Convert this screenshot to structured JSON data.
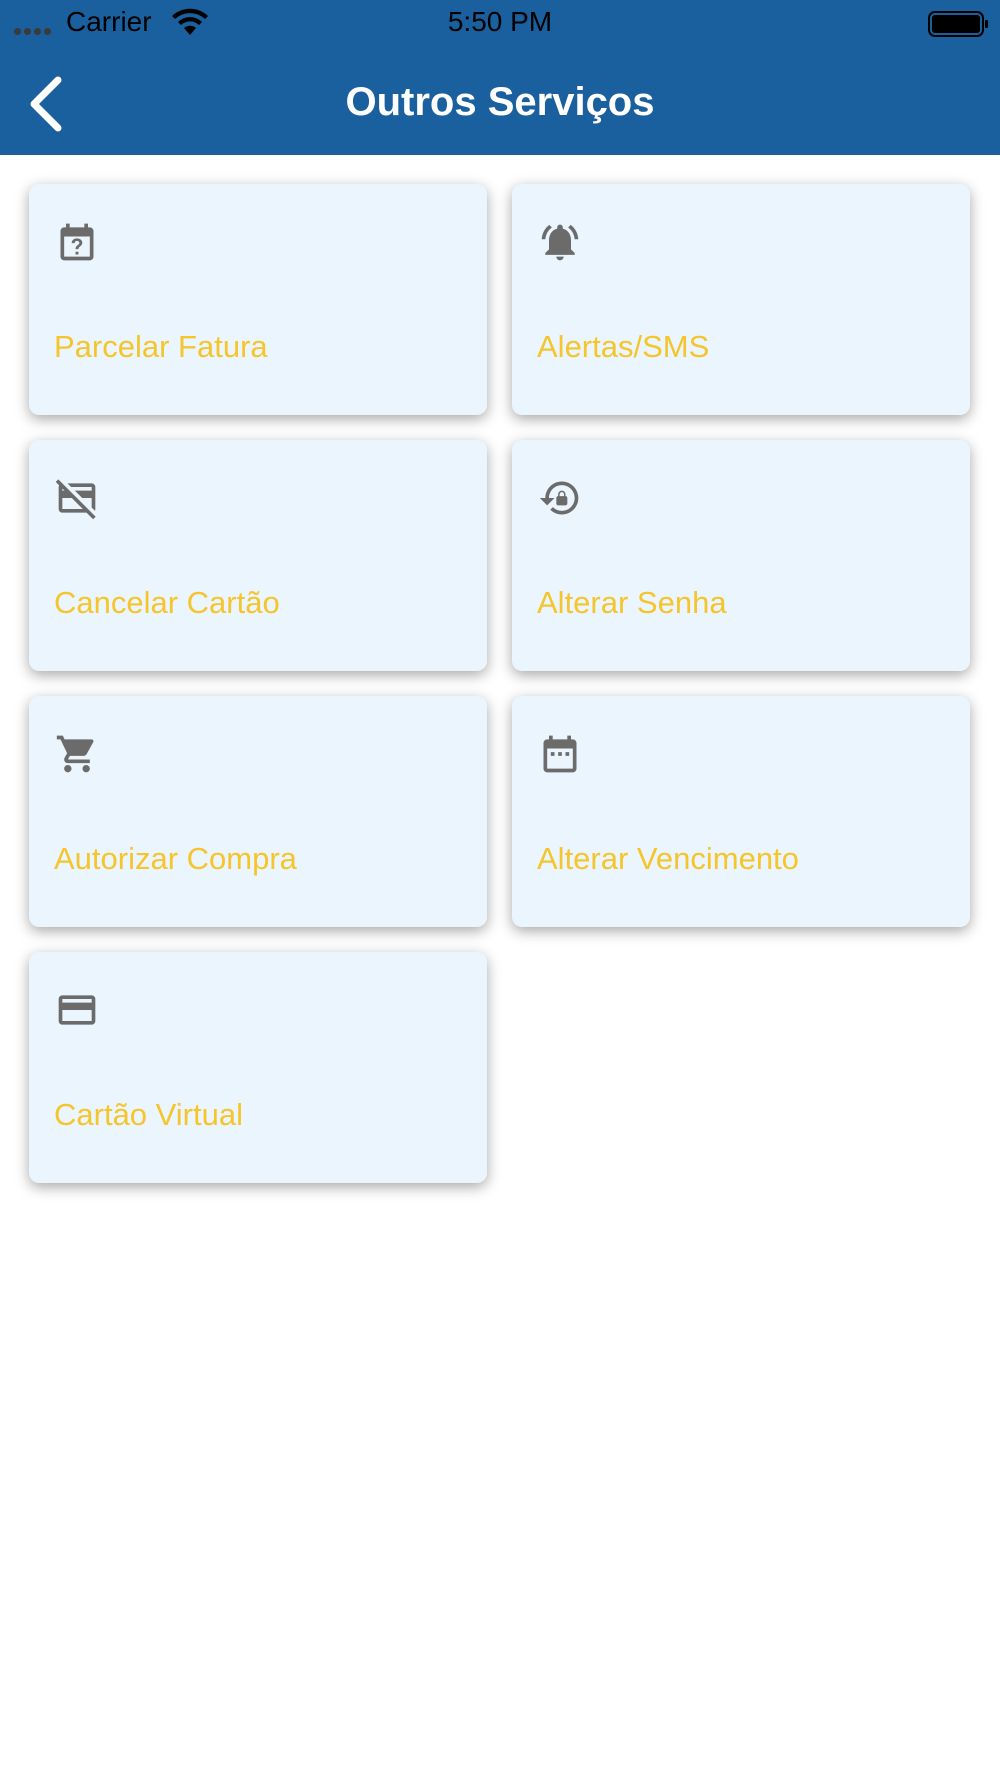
{
  "status_bar": {
    "carrier": "Carrier",
    "time": "5:50 PM"
  },
  "header": {
    "title": "Outros Serviços",
    "back_icon": "chevron-left-icon",
    "background_color": "#1a5f9e"
  },
  "colors": {
    "tile_background": "#eaf5fd",
    "tile_label": "#f5c52b",
    "icon": "#6b6b6b"
  },
  "services": [
    {
      "label": "Parcelar Fatura",
      "icon": "calendar-question-icon"
    },
    {
      "label": "Alertas/SMS",
      "icon": "bell-ringing-icon"
    },
    {
      "label": "Cancelar Cartão",
      "icon": "card-off-icon"
    },
    {
      "label": "Alterar Senha",
      "icon": "lock-reset-icon"
    },
    {
      "label": "Autorizar Compra",
      "icon": "cart-icon"
    },
    {
      "label": "Alterar Vencimento",
      "icon": "calendar-icon"
    },
    {
      "label": "Cartão Virtual",
      "icon": "credit-card-icon"
    }
  ]
}
